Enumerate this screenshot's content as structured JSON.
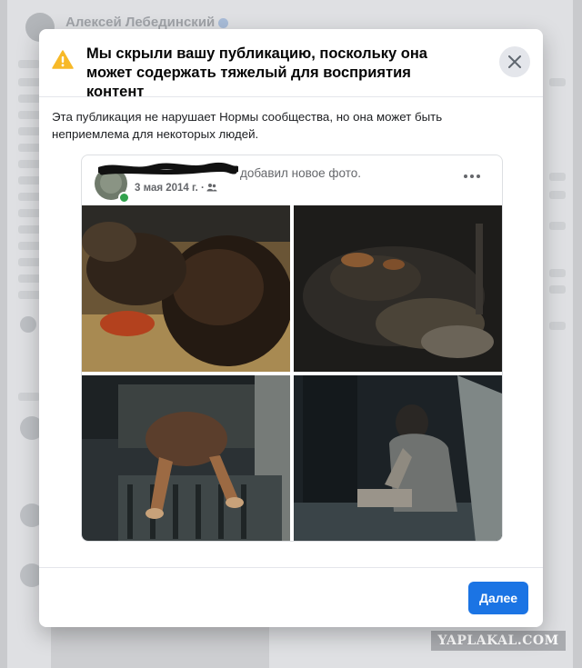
{
  "background": {
    "author_name": "Алексей Лебединский",
    "watermark": "YAPLAKAL.COM"
  },
  "modal": {
    "title": "Мы скрыли вашу публикацию, поскольку она может содержать тяжелый для восприятия контент",
    "description": "Эта публикация не нарушает Нормы сообщества, но она может быть неприемлема для некоторых людей.",
    "close_icon": "close-icon",
    "warning_icon": "warning-triangle-icon",
    "warning_color": "#f7b928",
    "next_label": "Далее",
    "accent_color": "#1b74e4"
  },
  "post": {
    "action_text": "добавил новое фото.",
    "date": "3 мая 2014 г. ·",
    "audience_icon": "friends-icon",
    "more_icon": "more-dots-icon",
    "reveal_icon": "eye-slash-icon"
  }
}
